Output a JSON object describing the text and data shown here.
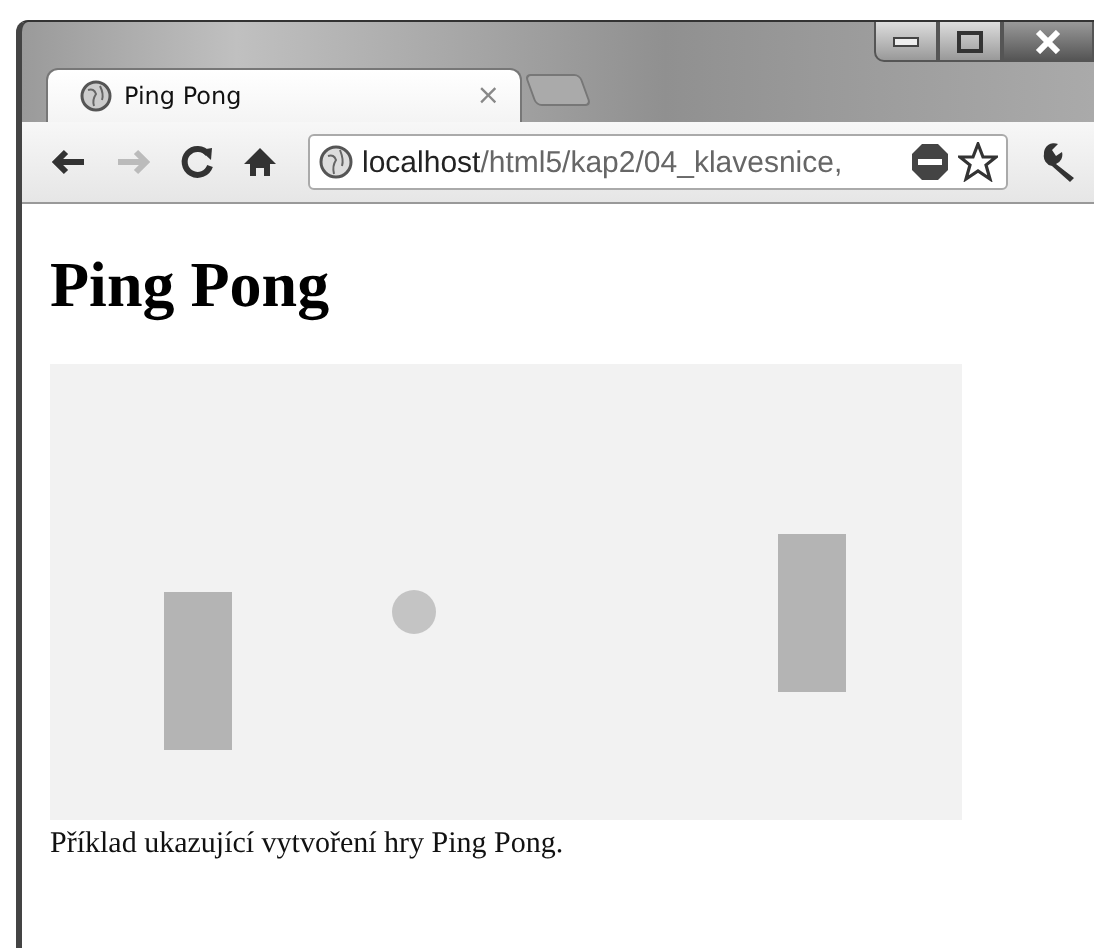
{
  "tabs": [
    {
      "title": "Ping Pong",
      "close": "×",
      "selected": true
    }
  ],
  "toolbar": {
    "forward_disabled": true
  },
  "address": {
    "host": "localhost",
    "path": "/html5/kap2/04_klavesnice,"
  },
  "page": {
    "heading": "Ping Pong",
    "caption": "Příklad ukazující vytvoření hry Ping Pong."
  }
}
